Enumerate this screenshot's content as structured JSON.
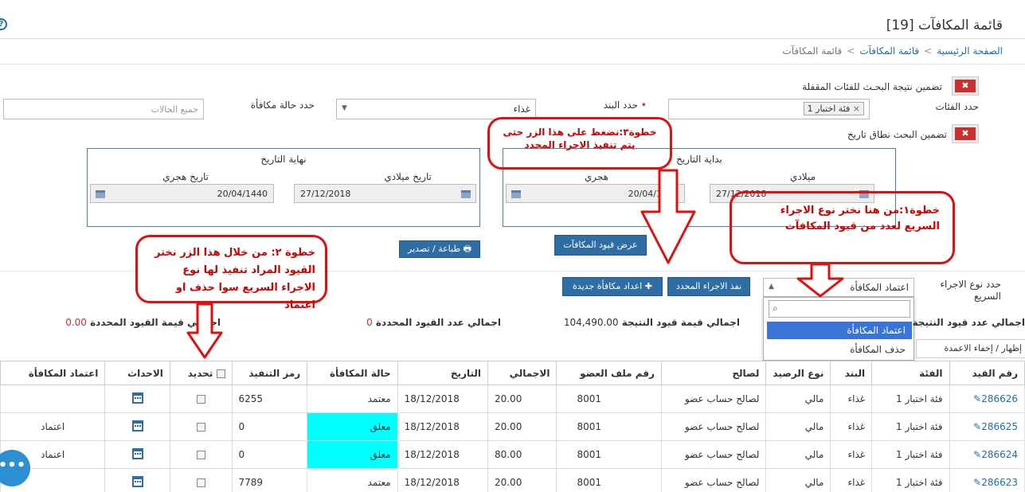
{
  "page": {
    "title": "قائمة المكافآت [19]",
    "breadcrumb": [
      "الصفحة الرئيسية",
      "قائمة المكافآت",
      "قائمة المكافآت"
    ]
  },
  "filters": {
    "include_frozen_label": "تضمين نتيجة البحـث للفئات المقفلة",
    "categories_label": "حدد الفئات",
    "category_tag": "فئة اختبار 1",
    "item_label": "حدد البند",
    "item_value": "غذاء",
    "status_label": "حدد حالة مكافأة",
    "status_placeholder": "جميع الحالات",
    "date_range_label": "تضمين البحث نطاق تاريخ",
    "x_symbol": "✖"
  },
  "start_date": {
    "title": "بداية التاريخ",
    "gregorian_label": "ميلادي",
    "hijri_label": "هجري",
    "gregorian_value": "27/12/2018",
    "hijri_value": "20/04/1440"
  },
  "end_date": {
    "title": "نهاية التاريخ",
    "gregorian_label": "تاريخ ميلادي",
    "hijri_label": "تاريخ هجري",
    "gregorian_value": "27/12/2018",
    "hijri_value": "20/04/1440"
  },
  "buttons": {
    "show": "عرض قيود المكافآت",
    "print": "طباعة / تصدير",
    "execute": "نفذ الاجراء المحدد",
    "new_reward": "اعداد مكافأة جديدة",
    "show_hide_columns": "إظهار / إخفاء الاعمدة"
  },
  "quick_action": {
    "label": "حدد نوع الاجراء السريع",
    "selected": "اعتماد المكافأة",
    "options": [
      "اعتماد المكافأة",
      "حذف المكافأة"
    ]
  },
  "callouts": {
    "step1": "خطوة١:من هنا نختر نوع الاجراء السريع لعدد من قيود المكافآت",
    "step2": "خطوة ٢: من خلال هذا الزر نختر القيود المراد تنفيذ لها نوع الاجراء السريع سوا حذف او اعتماد",
    "step3": "خطوة٣:نضغط على هذا الزر حتى يتم تنفيذ الاجراء المحدد"
  },
  "stats": {
    "total_records_label": "اجمالي عدد قيود النتيجة",
    "total_value_label": "اجمالي قيمة قيود النتيجة",
    "total_value": "104,490.00",
    "selected_count_label": "اجمالي عدد القيود المحددة",
    "selected_count": "0",
    "selected_value_label": "اجمالي قيمة القيود المحددة",
    "selected_value": "0.00"
  },
  "table": {
    "headers": [
      "رقم القيد",
      "الفئة",
      "البند",
      "نوع الرصيد",
      "لصالح",
      "رقم ملف العضو",
      "الاجمالي",
      "التاريخ",
      "حالة المكافأة",
      "رمز التنفيذ",
      "تحديد",
      "الاحداث",
      "اعتماد المكافأة"
    ],
    "rows": [
      {
        "id": "286626",
        "category": "فئة اختبار 1",
        "item": "غذاء",
        "balance": "مالي",
        "for": "لصالح حساب عضو",
        "member": "8001",
        "total": "20.00",
        "date": "18/12/2018",
        "status": "معتمد",
        "code": "6255",
        "approve": ""
      },
      {
        "id": "286625",
        "category": "فئة اختبار 1",
        "item": "غذاء",
        "balance": "مالي",
        "for": "لصالح حساب عضو",
        "member": "8001",
        "total": "20.00",
        "date": "18/12/2018",
        "status": "معلق",
        "code": "0",
        "approve": "اعتماد"
      },
      {
        "id": "286624",
        "category": "فئة اختبار 1",
        "item": "غذاء",
        "balance": "مالي",
        "for": "لصالح حساب عضو",
        "member": "8001",
        "total": "80.00",
        "date": "18/12/2018",
        "status": "معلق",
        "code": "0",
        "approve": "اعتماد"
      },
      {
        "id": "286623",
        "category": "فئة اختبار 1",
        "item": "غذاء",
        "balance": "مالي",
        "for": "لصالح حساب عضو",
        "member": "8001",
        "total": "20.00",
        "date": "18/12/2018",
        "status": "معتمد",
        "code": "7789",
        "approve": ""
      }
    ]
  },
  "chat_glyph": "•••"
}
